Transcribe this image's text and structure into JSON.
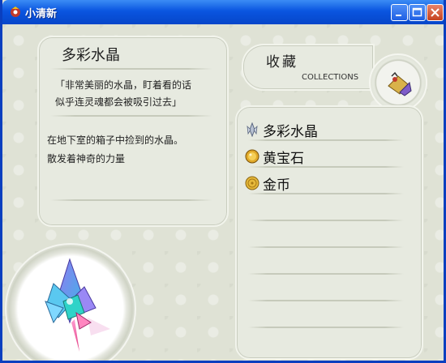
{
  "window": {
    "title": "小清新",
    "buttons": {
      "minimize": "minimize",
      "maximize": "maximize",
      "close": "close"
    }
  },
  "detail": {
    "name": "多彩水晶",
    "quote_line1": "「非常美丽的水晶，盯着看的话",
    "quote_line2": "似乎连灵魂都会被吸引过去」",
    "desc_line1": "在地下室的箱子中捡到的水晶。",
    "desc_line2": "散发着神奇的力量"
  },
  "collections": {
    "title_cn": "收藏",
    "title_en": "COLLECTIONS",
    "items": [
      {
        "label": "多彩水晶",
        "icon": "crystal-icon"
      },
      {
        "label": "黄宝石",
        "icon": "topaz-icon"
      },
      {
        "label": "金币",
        "icon": "gold-coin-icon"
      }
    ]
  },
  "colors": {
    "titlebar": "#0a55e0",
    "background": "#dfe2d5",
    "card": "#e7eae0"
  }
}
